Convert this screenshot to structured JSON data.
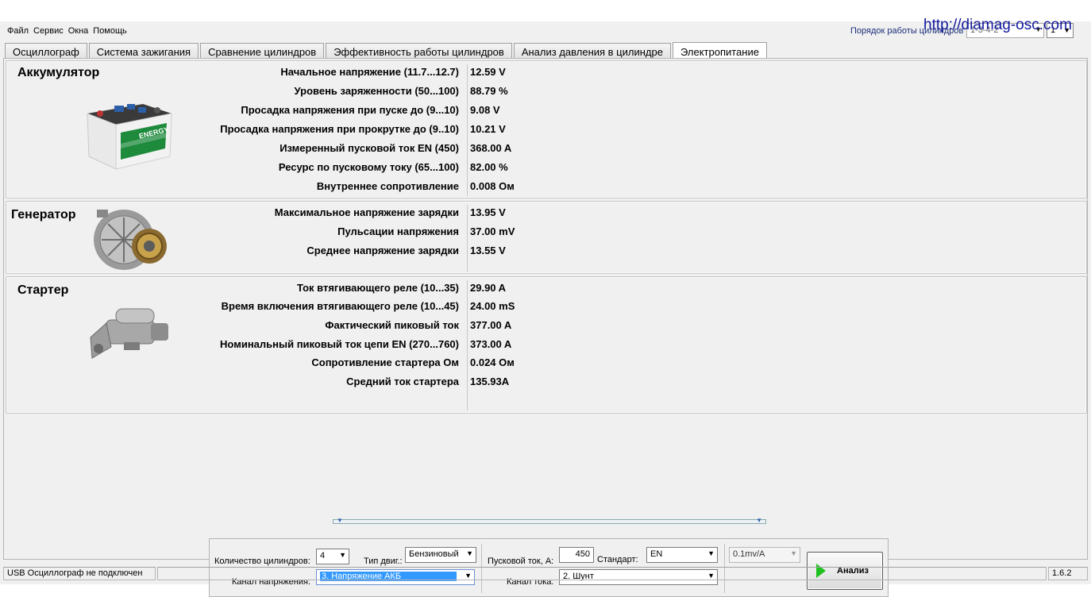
{
  "menu": [
    "Файл",
    "Сервис",
    "Окна",
    "Помощь"
  ],
  "url_overlay": "http://diamag-osc.com",
  "firing_order": {
    "label": "Порядок работы цилиндров",
    "value": "1-3-4-2",
    "value2": "1"
  },
  "tabs": [
    "Осциллограф",
    "Система зажигания",
    "Сравнение цилиндров",
    "Эффективность работы цилиндров",
    "Анализ давления в цилиндре",
    "Электропитание"
  ],
  "active_tab": "Электропитание",
  "battery": {
    "title": "Аккумулятор",
    "image_label": "ENERGY",
    "rows": [
      {
        "label": "Начальное напряжение (11.7...12.7)",
        "value": "12.59 V"
      },
      {
        "label": "Уровень заряженности (50...100)",
        "value": "88.79 %"
      },
      {
        "label": "Просадка напряжения при пуске до (9...10)",
        "value": "9.08 V"
      },
      {
        "label": "Просадка напряжения при прокрутке до  (9..10)",
        "value": "10.21 V"
      },
      {
        "label": "Измеренный пусковой ток  EN (450)",
        "value": "368.00 A"
      },
      {
        "label": "Ресурс по пусковому току (65...100)",
        "value": "82.00 %"
      },
      {
        "label": "Внутреннее сопротивление",
        "value": "0.008 Ом"
      }
    ]
  },
  "generator": {
    "title": "Генератор",
    "rows": [
      {
        "label": "Максимальное напряжение зарядки",
        "value": "13.95 V"
      },
      {
        "label": "Пульсации напряжения",
        "value": "37.00 mV"
      },
      {
        "label": "Среднее напряжение зарядки",
        "value": "13.55 V"
      }
    ]
  },
  "starter": {
    "title": "Стартер",
    "rows": [
      {
        "label": "Ток втягивающего реле (10...35)",
        "value": "29.90 A"
      },
      {
        "label": "Время включения втягивающего реле (10...45)",
        "value": "24.00 mS"
      },
      {
        "label": "Фактический пиковый ток",
        "value": "377.00 A"
      },
      {
        "label": "Номинальный пиковый ток цепи EN (270...760)",
        "value": "373.00 A"
      },
      {
        "label": "Сопротивление стартера Ом",
        "value": "0.024 Ом"
      },
      {
        "label": "Средний ток стартера",
        "value": "135.93A"
      }
    ]
  },
  "controls": {
    "cylinders_label": "Количество цилиндров:",
    "cylinders_value": "4",
    "engine_type_label": "Тип двиг.:",
    "engine_type_value": "Бензиновый",
    "voltage_channel_label": "Канал напряжения:",
    "voltage_channel_value": "3. Напряжение АКБ",
    "start_current_label": "Пусковой ток, А:",
    "start_current_value": "450",
    "standard_label": "Стандарт:",
    "standard_value": "EN",
    "current_channel_label": "Канал тока:",
    "current_channel_value": "2. Шунт",
    "sensitivity_value": "0.1mv/A",
    "analyze_button": "Анализ"
  },
  "status": {
    "connection": "USB Осциллограф не подключен",
    "version": "1.6.2"
  },
  "colors": {
    "accent": "#1fc11f",
    "url": "#10189c",
    "selection": "#3399ff"
  }
}
